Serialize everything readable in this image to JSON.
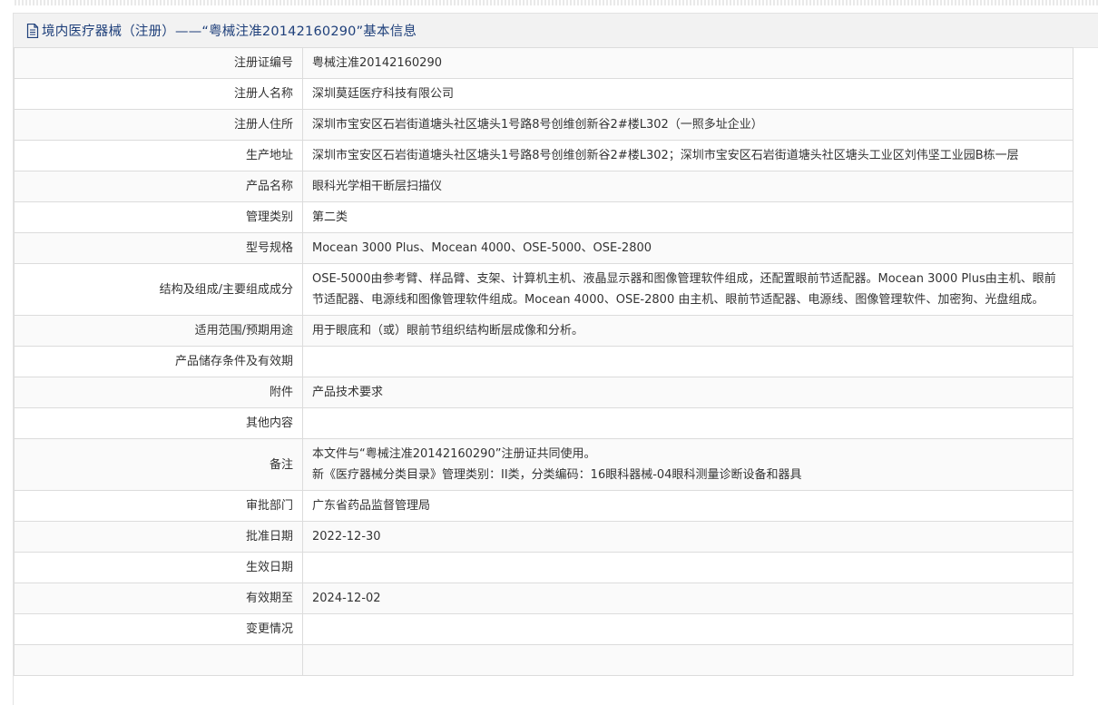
{
  "header": {
    "title": "境内医疗器械（注册）——“粤械注准20142160290”基本信息",
    "icon": "document-icon"
  },
  "rows": [
    {
      "key": "registration-number",
      "label": "注册证编号",
      "value": "粤械注准20142160290"
    },
    {
      "key": "registrant-name",
      "label": "注册人名称",
      "value": "深圳莫廷医疗科技有限公司"
    },
    {
      "key": "registrant-address",
      "label": "注册人住所",
      "value": "深圳市宝安区石岩街道塘头社区塘头1号路8号创维创新谷2#楼L302（一照多址企业）"
    },
    {
      "key": "production-address",
      "label": "生产地址",
      "value": "深圳市宝安区石岩街道塘头社区塘头1号路8号创维创新谷2#楼L302；深圳市宝安区石岩街道塘头社区塘头工业区刘伟坚工业园B栋一层"
    },
    {
      "key": "product-name",
      "label": "产品名称",
      "value": "眼科光学相干断层扫描仪"
    },
    {
      "key": "management-category",
      "label": "管理类别",
      "value": "第二类"
    },
    {
      "key": "model-spec",
      "label": "型号规格",
      "value": "Mocean 3000 Plus、Mocean 4000、OSE-5000、OSE-2800"
    },
    {
      "key": "structure-composition",
      "label": "结构及组成/主要组成成分",
      "value": "OSE-5000由参考臂、样品臂、支架、计算机主机、液晶显示器和图像管理软件组成，还配置眼前节适配器。Mocean 3000 Plus由主机、眼前节适配器、电源线和图像管理软件组成。Mocean 4000、OSE-2800 由主机、眼前节适配器、电源线、图像管理软件、加密狗、光盘组成。"
    },
    {
      "key": "intended-use",
      "label": "适用范围/预期用途",
      "value": "用于眼底和（或）眼前节组织结构断层成像和分析。"
    },
    {
      "key": "storage-conditions",
      "label": "产品储存条件及有效期",
      "value": ""
    },
    {
      "key": "attachments",
      "label": "附件",
      "value": "产品技术要求"
    },
    {
      "key": "other-content",
      "label": "其他内容",
      "value": ""
    },
    {
      "key": "remarks",
      "label": "备注",
      "lines": [
        "本文件与“粤械注准20142160290”注册证共同使用。",
        "新《医疗器械分类目录》管理类别：II类，分类编码：16眼科器械-04眼科测量诊断设备和器具"
      ]
    },
    {
      "key": "approval-department",
      "label": "审批部门",
      "value": "广东省药品监督管理局"
    },
    {
      "key": "approval-date",
      "label": "批准日期",
      "value": "2022-12-30"
    },
    {
      "key": "effective-date",
      "label": "生效日期",
      "value": ""
    },
    {
      "key": "valid-until",
      "label": "有效期至",
      "value": "2024-12-02"
    },
    {
      "key": "change-history",
      "label": "变更情况",
      "value": ""
    },
    {
      "key": "extra-row",
      "label": "",
      "value": ""
    }
  ]
}
